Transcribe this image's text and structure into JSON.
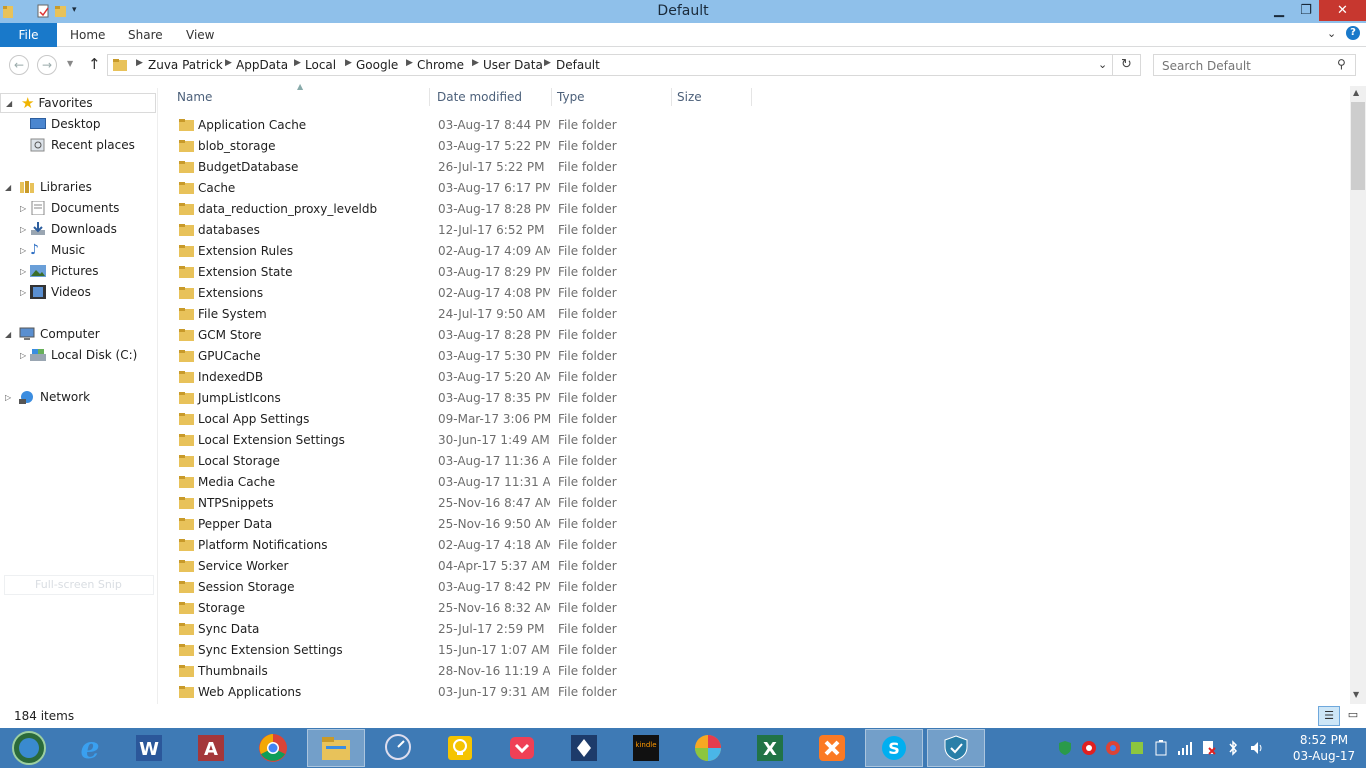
{
  "window": {
    "title": "Default"
  },
  "ribbon": {
    "tabs": [
      "File",
      "Home",
      "Share",
      "View"
    ]
  },
  "address": {
    "crumbs": [
      "Zuva Patrick",
      "AppData",
      "Local",
      "Google",
      "Chrome",
      "User Data",
      "Default"
    ]
  },
  "search": {
    "placeholder": "Search Default"
  },
  "nav": {
    "favorites": "Favorites",
    "desktop": "Desktop",
    "recent": "Recent places",
    "libraries": "Libraries",
    "documents": "Documents",
    "downloads": "Downloads",
    "music": "Music",
    "pictures": "Pictures",
    "videos": "Videos",
    "computer": "Computer",
    "localdisk": "Local Disk (C:)",
    "network": "Network",
    "snip": "Full-screen Snip"
  },
  "columns": {
    "name": "Name",
    "date": "Date modified",
    "type": "Type",
    "size": "Size"
  },
  "files": [
    {
      "name": "Application Cache",
      "date": "03-Aug-17 8:44 PM",
      "type": "File folder"
    },
    {
      "name": "blob_storage",
      "date": "03-Aug-17 5:22 PM",
      "type": "File folder"
    },
    {
      "name": "BudgetDatabase",
      "date": "26-Jul-17 5:22 PM",
      "type": "File folder"
    },
    {
      "name": "Cache",
      "date": "03-Aug-17 6:17 PM",
      "type": "File folder"
    },
    {
      "name": "data_reduction_proxy_leveldb",
      "date": "03-Aug-17 8:28 PM",
      "type": "File folder"
    },
    {
      "name": "databases",
      "date": "12-Jul-17 6:52 PM",
      "type": "File folder"
    },
    {
      "name": "Extension Rules",
      "date": "02-Aug-17 4:09 AM",
      "type": "File folder"
    },
    {
      "name": "Extension State",
      "date": "03-Aug-17 8:29 PM",
      "type": "File folder"
    },
    {
      "name": "Extensions",
      "date": "02-Aug-17 4:08 PM",
      "type": "File folder"
    },
    {
      "name": "File System",
      "date": "24-Jul-17 9:50 AM",
      "type": "File folder"
    },
    {
      "name": "GCM Store",
      "date": "03-Aug-17 8:28 PM",
      "type": "File folder"
    },
    {
      "name": "GPUCache",
      "date": "03-Aug-17 5:30 PM",
      "type": "File folder"
    },
    {
      "name": "IndexedDB",
      "date": "03-Aug-17 5:20 AM",
      "type": "File folder"
    },
    {
      "name": "JumpListIcons",
      "date": "03-Aug-17 8:35 PM",
      "type": "File folder"
    },
    {
      "name": "Local App Settings",
      "date": "09-Mar-17 3:06 PM",
      "type": "File folder"
    },
    {
      "name": "Local Extension Settings",
      "date": "30-Jun-17 1:49 AM",
      "type": "File folder"
    },
    {
      "name": "Local Storage",
      "date": "03-Aug-17 11:36 A...",
      "type": "File folder"
    },
    {
      "name": "Media Cache",
      "date": "03-Aug-17 11:31 A...",
      "type": "File folder"
    },
    {
      "name": "NTPSnippets",
      "date": "25-Nov-16 8:47 AM",
      "type": "File folder"
    },
    {
      "name": "Pepper Data",
      "date": "25-Nov-16 9:50 AM",
      "type": "File folder"
    },
    {
      "name": "Platform Notifications",
      "date": "02-Aug-17 4:18 AM",
      "type": "File folder"
    },
    {
      "name": "Service Worker",
      "date": "04-Apr-17 5:37 AM",
      "type": "File folder"
    },
    {
      "name": "Session Storage",
      "date": "03-Aug-17 8:42 PM",
      "type": "File folder"
    },
    {
      "name": "Storage",
      "date": "25-Nov-16 8:32 AM",
      "type": "File folder"
    },
    {
      "name": "Sync Data",
      "date": "25-Jul-17 2:59 PM",
      "type": "File folder"
    },
    {
      "name": "Sync Extension Settings",
      "date": "15-Jun-17 1:07 AM",
      "type": "File folder"
    },
    {
      "name": "Thumbnails",
      "date": "28-Nov-16 11:19 A...",
      "type": "File folder"
    },
    {
      "name": "Web Applications",
      "date": "03-Jun-17 9:31 AM",
      "type": "File folder"
    }
  ],
  "status": {
    "count": "184 items"
  },
  "clock": {
    "time": "8:52 PM",
    "date": "03-Aug-17"
  },
  "colors": {
    "titlebar": "#8fc0ea",
    "file_tab": "#1979ca",
    "taskbar": "#3e7ab5",
    "folder": "#e8c25a"
  },
  "icons": {
    "taskbar": [
      "start-orb-icon",
      "internet-explorer-icon",
      "word-icon",
      "access-icon",
      "chrome-icon",
      "file-explorer-icon",
      "network-meter-icon",
      "lightbulb-icon",
      "pocket-icon",
      "vpn-shield-icon",
      "kindle-icon",
      "color-wheel-icon",
      "excel-icon",
      "xampp-icon",
      "skype-icon",
      "security-shield-icon"
    ]
  }
}
